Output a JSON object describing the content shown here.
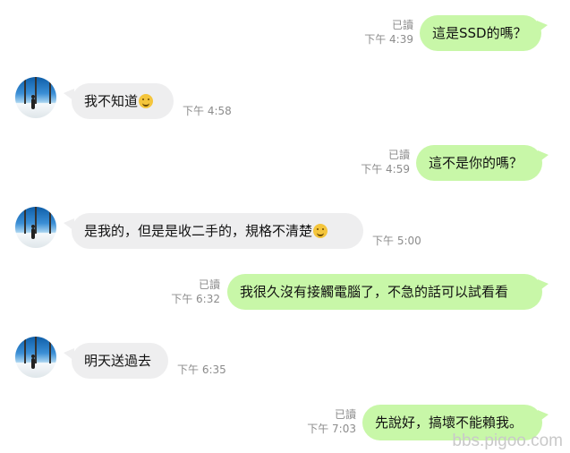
{
  "messages": [
    {
      "dir": "out",
      "text": "這是SSD的嗎？",
      "read": "已讀",
      "time": "下午 4:39"
    },
    {
      "dir": "in",
      "text": "我不知道",
      "emoji": "grinning-sweat-emoji",
      "time": "下午 4:58"
    },
    {
      "dir": "out",
      "text": "這不是你的嗎？",
      "read": "已讀",
      "time": "下午 4:59"
    },
    {
      "dir": "in",
      "text": "是我的，但是是收二手的，規格不清楚",
      "emoji": "sad-emoji",
      "time": "下午 5:00"
    },
    {
      "dir": "out",
      "text": "我很久沒有接觸電腦了，不急的話可以試看看",
      "read": "已讀",
      "time": "下午 6:32"
    },
    {
      "dir": "in",
      "text": "明天送過去",
      "time": "下午 6:35"
    },
    {
      "dir": "out",
      "text": "先說好，搞壞不能賴我。",
      "read": "已讀",
      "time": "下午 7:03"
    }
  ],
  "colors": {
    "outgoing": "#c8f7a8",
    "incoming": "#eeeeef",
    "meta": "#8c8c8c"
  },
  "watermark": "bbs.pigoo.com"
}
